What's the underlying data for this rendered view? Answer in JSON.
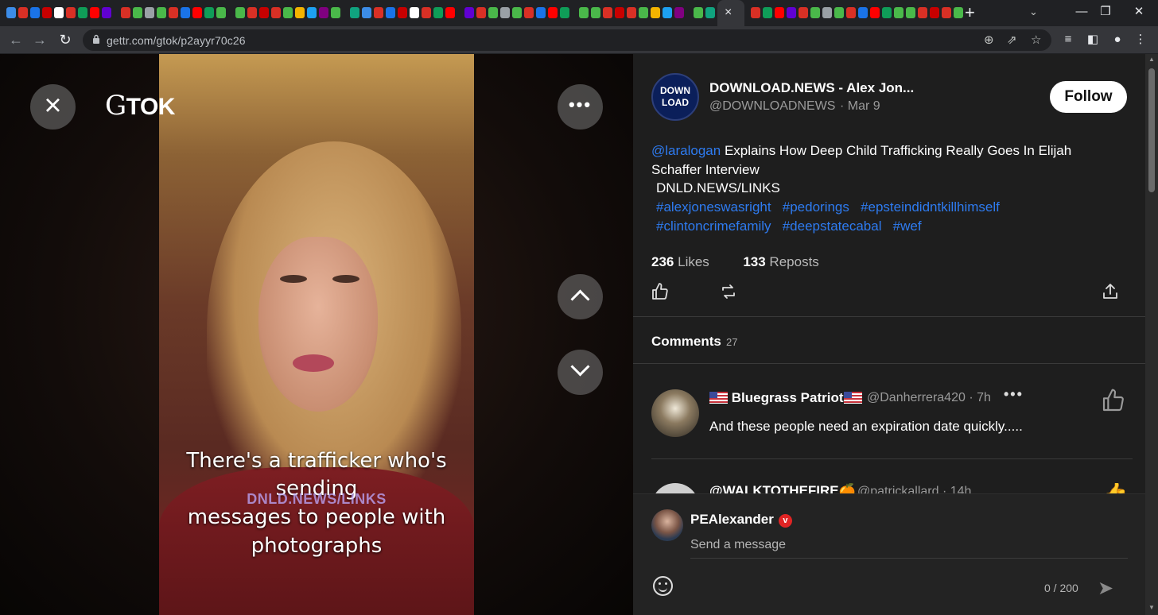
{
  "browser": {
    "url": "gettr.com/gtok/p2ayyr70c26",
    "new_tab": "+",
    "tab_close": "×",
    "tab_favicon_colors": [
      "#3c8ce7",
      "#d93025",
      "#1a73e8",
      "#c80000",
      "#ffffff",
      "#d93025",
      "#0f9d58",
      "#ff0000",
      "#6001d2",
      "#d93025",
      "#4ab84a",
      "#9aa0a6",
      "#4ab84a",
      "#d93025",
      "#1a73e8",
      "#ff0000",
      "#0f9d58",
      "#4ab84a",
      "#4ab84a",
      "#d93025",
      "#c80000",
      "#d93025",
      "#4ab84a",
      "#f4b400",
      "#1da1f2",
      "#800080",
      "#4ab84a",
      "#10a37f"
    ]
  },
  "video": {
    "logo_text": "TOK",
    "logo_glyph": "G",
    "caption_line1": "There's a trafficker who's",
    "caption_line2": "sending",
    "caption_line3": "messages to people with",
    "caption_line4": "photographs",
    "watermark": "DNLD.NEWS/LINKS",
    "more_label": "•••"
  },
  "post": {
    "avatar_line1": "DOWN",
    "avatar_line2": "LOAD",
    "author_name": "DOWNLOAD.NEWS - Alex Jon...",
    "author_handle": "@DOWNLOADNEWS",
    "date": "· Mar 9",
    "follow_label": "Follow",
    "mention": "@laralogan",
    "text_rest": "Explains How Deep Child Trafficking Really Goes In Elijah",
    "text_line2": "Schaffer Interview",
    "link": "DNLD.NEWS/LINKS",
    "tags_line1": [
      "#alexjoneswasright",
      "#pedorings",
      "#epsteindidntkillhimself"
    ],
    "tags_line2": [
      "#clintoncrimefamily",
      "#deepstatecabal",
      "#wef"
    ],
    "likes_count": "236",
    "likes_label": "Likes",
    "reposts_count": "133",
    "reposts_label": "Reposts",
    "like_icon": "👍",
    "repost_icon": "⟲",
    "share_icon": "⇪"
  },
  "comments": {
    "title": "Comments",
    "count": "27",
    "items": [
      {
        "name": "Bluegrass Patriot",
        "handle": "@Danherrera420 · 7h",
        "more": "•••",
        "text": "And these people need an expiration date quickly.....",
        "like_icon": "👍"
      },
      {
        "name": "@WALKTOTHEFIRE🍊",
        "handle": "@patrickallard · 14h",
        "like_icon": "👍"
      }
    ]
  },
  "composer": {
    "user_name": "PEAlexander",
    "verified_mark": "v",
    "placeholder": "Send a message",
    "char_count": "0 / 200",
    "send_icon": "➤"
  }
}
